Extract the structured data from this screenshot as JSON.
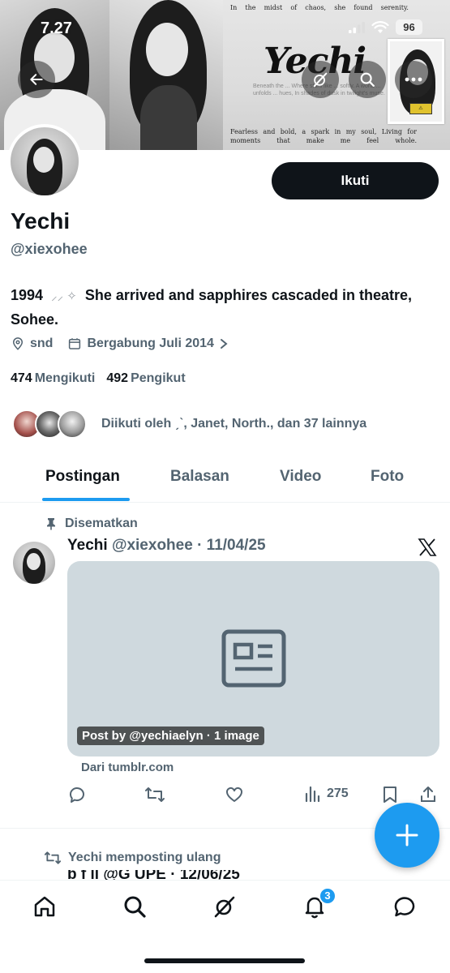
{
  "status_bar": {
    "time": "7.27",
    "battery": "96"
  },
  "banner": {
    "quote_top": [
      "In",
      "the",
      "midst",
      "of",
      "chaos,",
      "she",
      "found",
      "serenity."
    ],
    "title": "Yechi",
    "small_text": "Beneath the ... Where stars like ... softly. A world ... unfolds ... hues, In shades of dusk in twilight's muse.",
    "quote_bottom": "Fearless and bold, a spark in my soul, Living for moments that make me feel whole."
  },
  "profile": {
    "follow_label": "Ikuti",
    "display_name": "Yechi",
    "handle": "@xiexohee",
    "bio_year": "1994",
    "bio_sparkles": "⸝⸝ ✧",
    "bio_text": "She arrived and sapphires cascaded in theatre, Sohee.",
    "location": "snd",
    "joined": "Bergabung Juli 2014",
    "following_count": "474",
    "following_label": "Mengikuti",
    "followers_count": "492",
    "followers_label": "Pengikut",
    "followed_by": "Diikuti oleh ˏˋ, Janet, North., dan 37 lainnya"
  },
  "tabs": [
    {
      "label": "Postingan",
      "active": true
    },
    {
      "label": "Balasan",
      "active": false
    },
    {
      "label": "Video",
      "active": false
    },
    {
      "label": "Foto",
      "active": false
    }
  ],
  "pinned_post": {
    "pinned_label": "Disematkan",
    "name": "Yechi",
    "meta": "@xiexohee · 11/04/25",
    "card_label": "Post by @yechiaelyn · 1 image",
    "card_source": "Dari tumblr.com",
    "views": "275"
  },
  "next_post": {
    "repost_label": "Yechi memposting ulang",
    "partial_text": "b         f ll    @G    UPE · 12/06/25"
  },
  "notifications_badge": "3",
  "colors": {
    "accent": "#1d9bf0",
    "text": "#0f1419",
    "secondary": "#536471",
    "card": "#cfd9de"
  }
}
